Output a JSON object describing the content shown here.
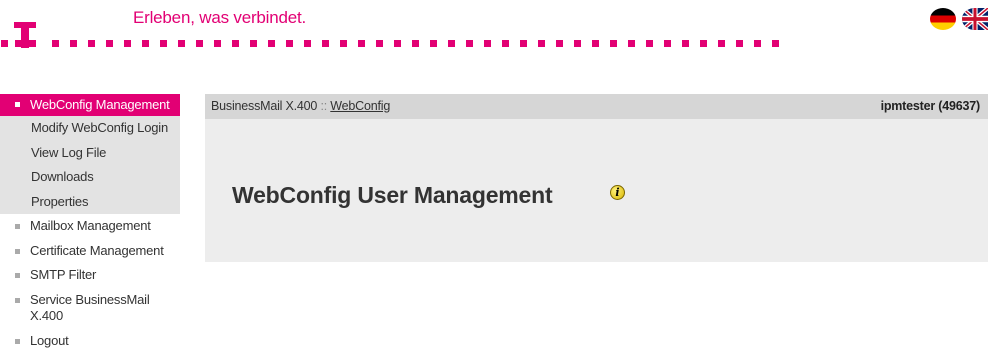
{
  "header": {
    "tagline": "Erleben, was verbindet.",
    "brand_color": "#e20074",
    "flags": [
      {
        "name": "german-flag",
        "language": "de"
      },
      {
        "name": "uk-flag",
        "language": "en"
      }
    ]
  },
  "sidebar": {
    "active": {
      "label": "WebConfig Management"
    },
    "sub_items": [
      {
        "label": "Modify WebConfig Login"
      },
      {
        "label": "View Log File"
      },
      {
        "label": "Downloads"
      },
      {
        "label": "Properties"
      }
    ],
    "items": [
      {
        "label": "Mailbox Management"
      },
      {
        "label": "Certificate Management"
      },
      {
        "label": "SMTP Filter"
      },
      {
        "label": "Service BusinessMail X.400"
      },
      {
        "label": "Logout"
      }
    ]
  },
  "content": {
    "breadcrumb": {
      "root": "BusinessMail X.400",
      "separator": "::",
      "current": "WebConfig"
    },
    "user": "ipmtester (49637)",
    "title": "WebConfig User Management",
    "info_icon": "info-icon"
  }
}
